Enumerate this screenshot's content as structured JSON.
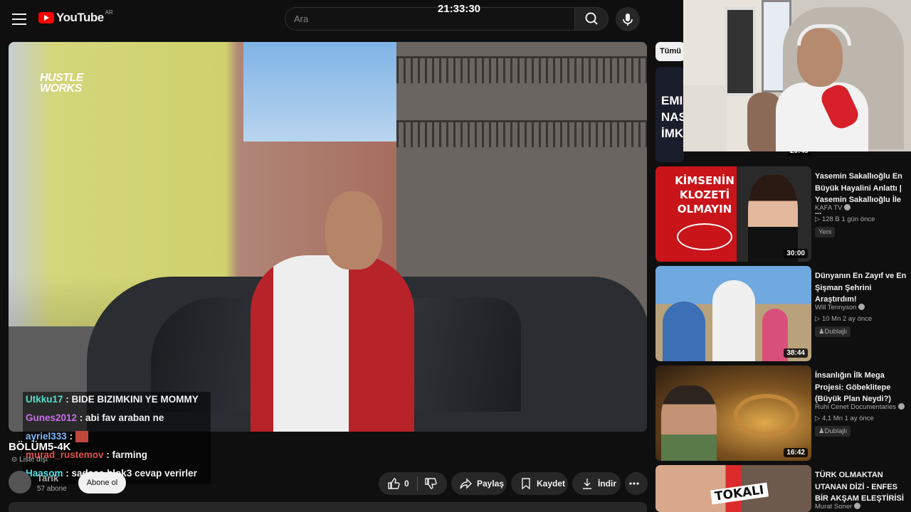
{
  "header": {
    "logo_text": "YouTube",
    "country_code": "AR",
    "search_placeholder": "Ara",
    "clock": "21:33:30"
  },
  "video": {
    "overlay_logo": "HUSTLE\nWORKS",
    "episode_label": "BÖLÜM5-4K",
    "list_label": "Liste dışı"
  },
  "chat": [
    {
      "user": "Utkku17",
      "color": "#4fe0c8",
      "message": " : BIDE BIZIMKINI YE MOMMY"
    },
    {
      "user": "Gunes2012",
      "color": "#c86fe8",
      "message": " : abi fav araban ne"
    },
    {
      "user": "ayriel333",
      "color": "#7fb8ff",
      "message": " :"
    },
    {
      "user": "murad_rustemov",
      "color": "#e0504a",
      "message": " : farming"
    },
    {
      "user": "Haasom",
      "color": "#4fe0e8",
      "message": " : sadece blok3 cevap verirler"
    }
  ],
  "channel": {
    "name": "Tarık",
    "subscribers": "57 abone",
    "subscribe_label": "Abone ol"
  },
  "actions": {
    "like_count": "0",
    "share_label": "Paylaş",
    "save_label": "Kaydet",
    "download_label": "İndir"
  },
  "sidebar": {
    "chip_label": "Tümü",
    "partial_duration": "29:48",
    "partial_thumb_text": "EMI\nNAS\nİMKA",
    "recommendations": [
      {
        "title": "Yasemin Sakallıoğlu En Büyük Hayalini Anlattı | Yasemin Sakallıoğlu İle ...",
        "channel": "KAFA TV",
        "meta": "▷ 128 B   1 gün önce",
        "badge": "Yeni",
        "duration": "30:00",
        "thumb_text": "KİMSENİN KLOZETİ OLMAYIN"
      },
      {
        "title": "Dünyanın En Zayıf ve En Şişman Şehrini Araştırdım!",
        "channel": "Will Tennyson",
        "meta": "▷ 10 Mn   2 ay önce",
        "badge": "Dublajlı",
        "duration": "38:44"
      },
      {
        "title": "İnsanlığın İlk Mega Projesi: Göbeklitepe (Büyük Plan Neydi?)",
        "channel": "Ruhi Cenet Documentaries",
        "meta": "▷ 4,1 Mn   1 ay önce",
        "badge": "Dublajlı",
        "duration": "16:42"
      },
      {
        "title": "TÜRK OLMAKTAN UTANAN DİZİ - ENFES BİR AKŞAM ELEŞTİRİSİ",
        "channel": "Murat Soner",
        "thumb_text": "TOKALI"
      }
    ]
  }
}
